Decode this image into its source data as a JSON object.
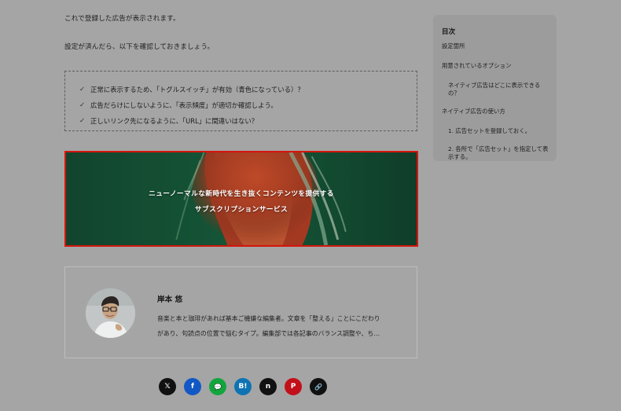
{
  "article": {
    "paragraphs": [
      "これで登録した広告が表示されます。",
      "設定が済んだら、以下を確認しておきましょう。"
    ],
    "checklist": [
      "正常に表示するため、「トグルスイッチ」が有効（青色になっている）？",
      "広告だらけにしないように、「表示頻度」が適切か確認しよう。",
      "正しいリンク先になるように、「URL」に間違いはない？"
    ],
    "check_symbol": "✓"
  },
  "banner": {
    "line1": "ニューノーマルな新時代を生き抜くコンテンツを提供する",
    "line2": "サブスクリプションサービス",
    "highlight_color": "#d4150b"
  },
  "author": {
    "name": "岸本 悠",
    "bio_line1": "音楽と本と珈琲があれば基本ご機嫌な編集者。文章を「整える」ことにこだわり",
    "bio_line2": "があり、句読点の位置で悩むタイプ。編集部では各記事のバランス調整や、ち…"
  },
  "social": [
    {
      "name": "x-share-button",
      "icon": "x-icon",
      "glyph": "𝕏",
      "color": "#111111"
    },
    {
      "name": "facebook-share-button",
      "icon": "facebook-icon",
      "glyph": "f",
      "color": "#1258c4"
    },
    {
      "name": "line-share-button",
      "icon": "line-icon",
      "glyph": "💬",
      "color": "#12a53d"
    },
    {
      "name": "hatena-bookmark-button",
      "icon": "hatena-bookmark-icon",
      "glyph": "B!",
      "color": "#0f73b3"
    },
    {
      "name": "note-share-button",
      "icon": "note-icon",
      "glyph": "n",
      "color": "#111111"
    },
    {
      "name": "pinterest-share-button",
      "icon": "pinterest-icon",
      "glyph": "P",
      "color": "#c2101b"
    },
    {
      "name": "copy-link-button",
      "icon": "link-icon",
      "glyph": "🔗",
      "color": "#111111"
    }
  ],
  "toc": {
    "title": "目次",
    "items": [
      {
        "label": "設定箇所",
        "level": 1
      },
      {
        "label": "用意されているオプション",
        "level": 1
      },
      {
        "label": "ネイティブ広告はどこに表示できるの？",
        "level": 2
      },
      {
        "label": "ネイティブ広告の使い方",
        "level": 1
      },
      {
        "label": "1. 広告セットを登録しておく。",
        "level": 2
      },
      {
        "label": "2. 各所で「広告セット」を指定して表示する。",
        "level": 2
      }
    ]
  }
}
